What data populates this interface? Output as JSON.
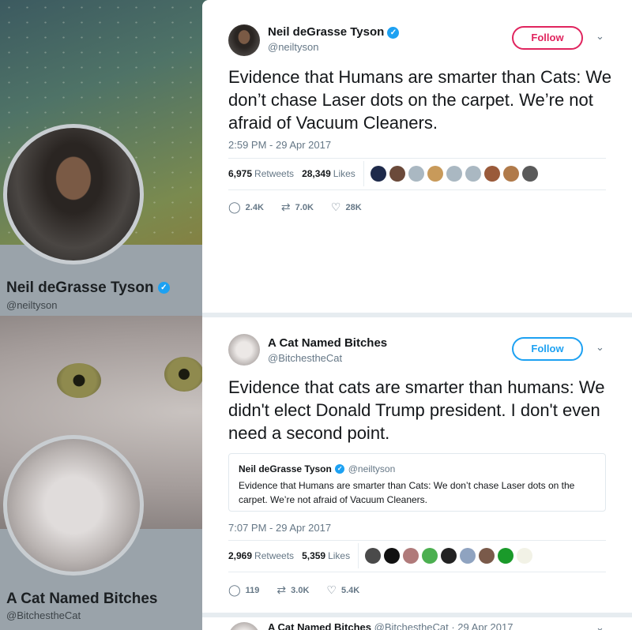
{
  "background": {
    "profile1": {
      "name": "Neil deGrasse Tyson",
      "handle": "@neiltyson"
    },
    "profile2": {
      "name": "A Cat Named Bitches",
      "handle": "@BitchestheCat"
    }
  },
  "tweets": [
    {
      "name": "Neil deGrasse Tyson",
      "handle": "@neiltyson",
      "follow_label": "Follow",
      "text": "Evidence that Humans are smarter than Cats:  We don’t chase Laser dots on the carpet. We’re not afraid of Vacuum Cleaners.",
      "timestamp": "2:59 PM - 29 Apr 2017",
      "retweets_count": "6,975",
      "retweets_label": "Retweets",
      "likes_count": "28,349",
      "likes_label": "Likes",
      "reply_count": "2.4K",
      "retweet_count_short": "7.0K",
      "like_count_short": "28K"
    },
    {
      "name": "A Cat Named Bitches",
      "handle": "@BitchestheCat",
      "follow_label": "Follow",
      "text": "Evidence that cats are smarter than humans: We didn't elect Donald Trump president. I don't even need a second point.",
      "quote": {
        "name": "Neil deGrasse Tyson",
        "handle": "@neiltyson",
        "text": "Evidence that Humans are smarter than Cats:  We don’t chase Laser dots on the carpet. We’re not afraid of Vacuum Cleaners."
      },
      "timestamp": "7:07 PM - 29 Apr 2017",
      "retweets_count": "2,969",
      "retweets_label": "Retweets",
      "likes_count": "5,359",
      "likes_label": "Likes",
      "reply_count": "119",
      "retweet_count_short": "3.0K",
      "like_count_short": "5.4K"
    }
  ],
  "next_tweet": {
    "name": "A Cat Named Bitches",
    "meta": "@BitchestheCat · 29 Apr 2017"
  },
  "icons": {
    "verified": "✓",
    "chevron": "⌄",
    "reply": "◯",
    "retweet": "⇄",
    "like": "♡"
  },
  "colors": {
    "follow_red": "#e0245e",
    "follow_blue": "#1da1f2",
    "verified": "#1da1f2",
    "secondary_text": "#657786"
  }
}
